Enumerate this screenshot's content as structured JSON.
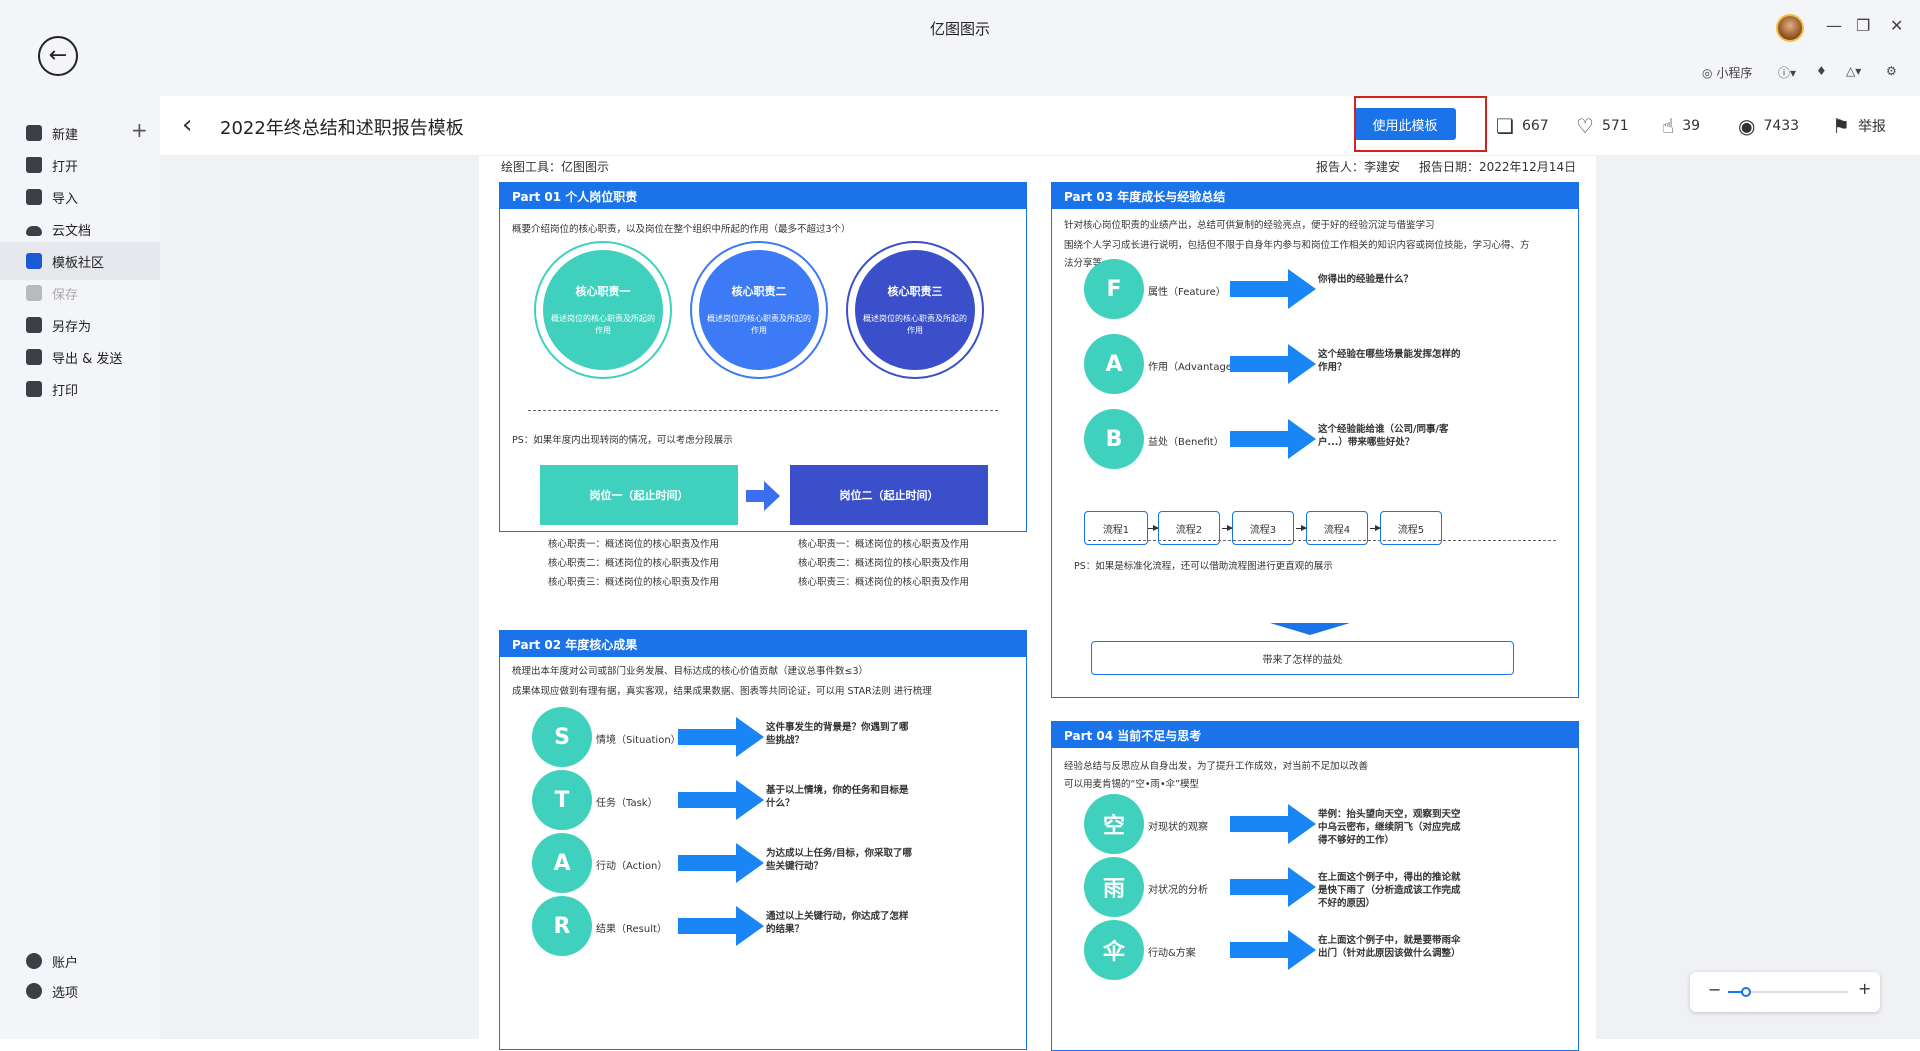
{
  "app": {
    "title": "亿图图示",
    "toolbar": {
      "miniprogram": "小程序"
    }
  },
  "sidebar": {
    "items": [
      {
        "label": "新建",
        "icon": "new-file-icon"
      },
      {
        "label": "打开",
        "icon": "folder-icon"
      },
      {
        "label": "导入",
        "icon": "import-icon"
      },
      {
        "label": "云文档",
        "icon": "cloud-icon"
      },
      {
        "label": "模板社区",
        "icon": "template-community-icon"
      },
      {
        "label": "保存",
        "icon": "save-icon"
      },
      {
        "label": "另存为",
        "icon": "save-as-icon"
      },
      {
        "label": "导出 & 发送",
        "icon": "export-icon"
      },
      {
        "label": "打印",
        "icon": "print-icon"
      }
    ],
    "bottom": [
      {
        "label": "账户",
        "icon": "account-icon"
      },
      {
        "label": "选项",
        "icon": "settings-icon"
      }
    ]
  },
  "header": {
    "title": "2022年终总结和述职报告模板",
    "use_button": "使用此模板",
    "copies": "667",
    "likes": "571",
    "thumbs": "39",
    "views": "7433",
    "report": "举报"
  },
  "doc": {
    "tool": "绘图工具：亿图图示",
    "reporter": "报告人：李建安",
    "date": "报告日期：2022年12月14日",
    "part1": {
      "title": "Part 01  个人岗位职责",
      "intro": "概要介绍岗位的核心职责，以及岗位在整个组织中所起的作用（最多不超过3个）",
      "circles": [
        {
          "title": "核心职责一",
          "desc": "概述岗位的核心职责及所起的作用"
        },
        {
          "title": "核心职责二",
          "desc": "概述岗位的核心职责及所起的作用"
        },
        {
          "title": "核心职责三",
          "desc": "概述岗位的核心职责及所起的作用"
        }
      ],
      "ps": "PS：如果年度内出现转岗的情况，可以考虑分段展示",
      "pos1": "岗位一（起止时间）",
      "pos2": "岗位二（起止时间）",
      "lines1": [
        "核心职责一：概述岗位的核心职责及作用",
        "核心职责二：概述岗位的核心职责及作用",
        "核心职责三：概述岗位的核心职责及作用"
      ],
      "lines2": [
        "核心职责一：概述岗位的核心职责及作用",
        "核心职责二：概述岗位的核心职责及作用",
        "核心职责三：概述岗位的核心职责及作用"
      ]
    },
    "part2": {
      "title": "Part 02  年度核心成果",
      "intro1": "梳理出本年度对公司或部门业务发展、目标达成的核心价值贡献（建议总事件数≤3）",
      "intro2": "成果体现应做到有理有据，真实客观，结果成果数据、图表等共同论证，可以用  STAR法则 进行梳理",
      "rows": [
        {
          "letter": "S",
          "label": "情境（Situation）",
          "desc": "这件事发生的背景是？你遇到了哪些挑战？"
        },
        {
          "letter": "T",
          "label": "任务（Task）",
          "desc": "基于以上情境，你的任务和目标是什么？"
        },
        {
          "letter": "A",
          "label": "行动（Action）",
          "desc": "为达成以上任务/目标，你采取了哪些关键行动？"
        },
        {
          "letter": "R",
          "label": "结果（Result）",
          "desc": "通过以上关键行动，你达成了怎样的结果？"
        }
      ]
    },
    "part3": {
      "title": "Part 03  年度成长与经验总结",
      "intro1": "针对核心岗位职责的业绩产出，总结可供复制的经验亮点，便于好的经验沉淀与借鉴学习",
      "intro2": "围绕个人学习成长进行说明，包括但不限于自身年内参与和岗位工作相关的知识内容或岗位技能，学习心得、方",
      "intro3": "法分享等",
      "rows": [
        {
          "letter": "F",
          "label": "属性（Feature）",
          "desc": "你得出的经验是什么？"
        },
        {
          "letter": "A",
          "label": "作用（Advantage）",
          "desc": "这个经验在哪些场景能发挥怎样的作用？"
        },
        {
          "letter": "B",
          "label": "益处（Benefit）",
          "desc": "这个经验能给谁（公司/同事/客户...）带来哪些好处？"
        }
      ],
      "ps": "PS：如果是标准化流程，还可以借助流程图进行更直观的展示",
      "flows": [
        "流程1",
        "流程2",
        "流程3",
        "流程4",
        "流程5"
      ],
      "result": "带来了怎样的益处"
    },
    "part4": {
      "title": "Part 04  当前不足与思考",
      "intro1": "经验总结与反思应从自身出发，为了提升工作成效，对当前不足加以改善",
      "intro2": "可以用麦肯锡的“空•雨•伞”模型",
      "rows": [
        {
          "letter": "空",
          "label": "对现状的观察",
          "desc": "举例：抬头望向天空，观察到天空中乌云密布，继续阴飞（对应完成得不够好的工作）"
        },
        {
          "letter": "雨",
          "label": "对状况的分析",
          "desc": "在上面这个例子中，得出的推论就是快下雨了（分析造成该工作完成不好的原因）"
        },
        {
          "letter": "伞",
          "label": "行动&方案",
          "desc": "在上面这个例子中，就是要带雨伞出门（针对此原因该做什么调整）"
        }
      ]
    }
  },
  "zoom": {
    "minus": "−",
    "plus": "+",
    "level": 0.15
  }
}
